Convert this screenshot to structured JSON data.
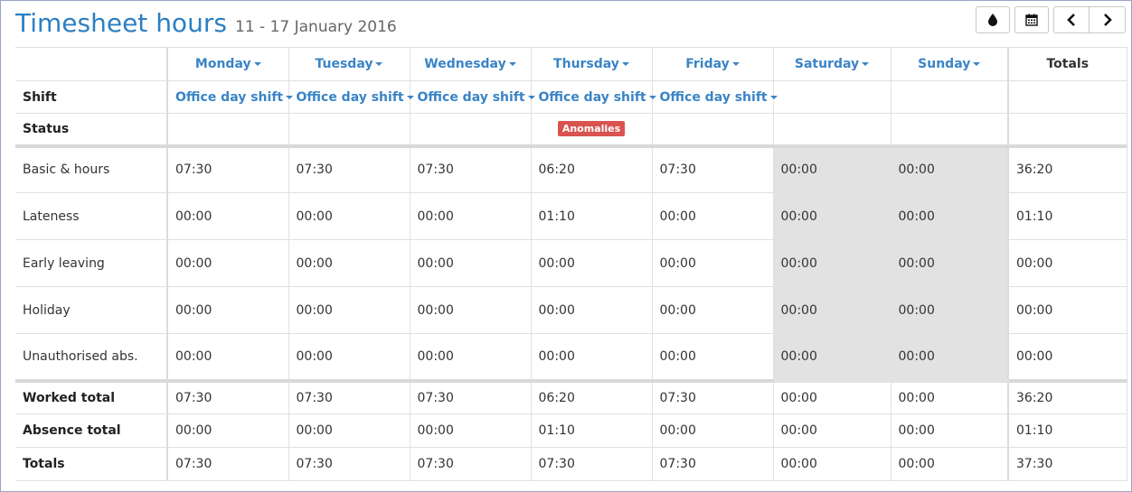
{
  "header": {
    "title": "Timesheet hours",
    "date_range": "11 - 17 January 2016"
  },
  "toolbar": {
    "buttons": [
      {
        "icon": "drop-icon"
      },
      {
        "icon": "calendar-icon"
      },
      {
        "icon": "chevron-left-icon"
      },
      {
        "icon": "chevron-right-icon"
      }
    ]
  },
  "table": {
    "days": [
      "Monday",
      "Tuesday",
      "Wednesday",
      "Thursday",
      "Friday",
      "Saturday",
      "Sunday"
    ],
    "totals_header": "Totals",
    "shift_label": "Shift",
    "shifts": [
      "Office day shift",
      "Office day shift",
      "Office day shift",
      "Office day shift",
      "Office day shift",
      "",
      ""
    ],
    "status_label": "Status",
    "status_badge": "Anomalies",
    "rows": [
      {
        "label": "Basic & hours",
        "values": [
          "07:30",
          "07:30",
          "07:30",
          "06:20",
          "07:30",
          "00:00",
          "00:00"
        ],
        "total": "36:20"
      },
      {
        "label": "Lateness",
        "values": [
          "00:00",
          "00:00",
          "00:00",
          "01:10",
          "00:00",
          "00:00",
          "00:00"
        ],
        "total": "01:10"
      },
      {
        "label": "Early leaving",
        "values": [
          "00:00",
          "00:00",
          "00:00",
          "00:00",
          "00:00",
          "00:00",
          "00:00"
        ],
        "total": "00:00"
      },
      {
        "label": "Holiday",
        "values": [
          "00:00",
          "00:00",
          "00:00",
          "00:00",
          "00:00",
          "00:00",
          "00:00"
        ],
        "total": "00:00"
      },
      {
        "label": "Unauthorised abs.",
        "values": [
          "00:00",
          "00:00",
          "00:00",
          "00:00",
          "00:00",
          "00:00",
          "00:00"
        ],
        "total": "00:00"
      }
    ],
    "footer": [
      {
        "label": "Worked total",
        "values": [
          "07:30",
          "07:30",
          "07:30",
          "06:20",
          "07:30",
          "00:00",
          "00:00"
        ],
        "total": "36:20"
      },
      {
        "label": "Absence total",
        "values": [
          "00:00",
          "00:00",
          "00:00",
          "01:10",
          "00:00",
          "00:00",
          "00:00"
        ],
        "total": "01:10"
      },
      {
        "label": "Totals",
        "values": [
          "07:30",
          "07:30",
          "07:30",
          "07:30",
          "07:30",
          "00:00",
          "00:00"
        ],
        "total": "37:30"
      }
    ]
  },
  "colors": {
    "accent": "#2b7fc3",
    "link": "#3a84c6",
    "badge": "#d9534f",
    "weekend_bg": "#e2e2e2"
  }
}
